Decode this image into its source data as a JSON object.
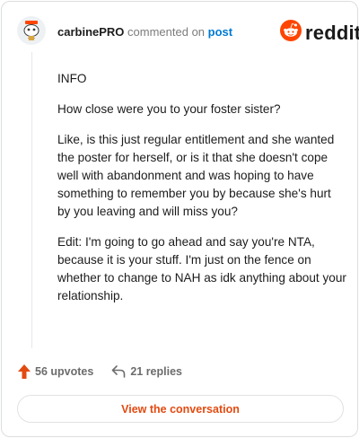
{
  "header": {
    "username": "carbinePRO",
    "action_text": "commented on",
    "post_link": "post",
    "logo_text": "reddit"
  },
  "comment": {
    "paragraphs": [
      "INFO",
      "How close were you to your foster sister?",
      "Like, is this just regular entitlement and she wanted the poster for herself, or is it that she doesn't cope well with abandonment and was hoping to have something to remember you by because she's hurt by you leaving and will miss you?",
      "Edit: I'm going to go ahead and say you're NTA, because it is your stuff. I'm just on the fence on whether to change to NAH as idk anything about your relationship."
    ]
  },
  "actions": {
    "upvotes": "56 upvotes",
    "replies": "21 replies"
  },
  "cta": {
    "label": "View the conversation"
  },
  "colors": {
    "accent": "#e34a10",
    "upvote": "#e34a10",
    "link": "#0079d3",
    "reddit_orange": "#ff4500"
  },
  "icons": [
    "avatar",
    "reddit-logo-icon",
    "upvote-arrow-icon",
    "reply-arrow-icon"
  ]
}
